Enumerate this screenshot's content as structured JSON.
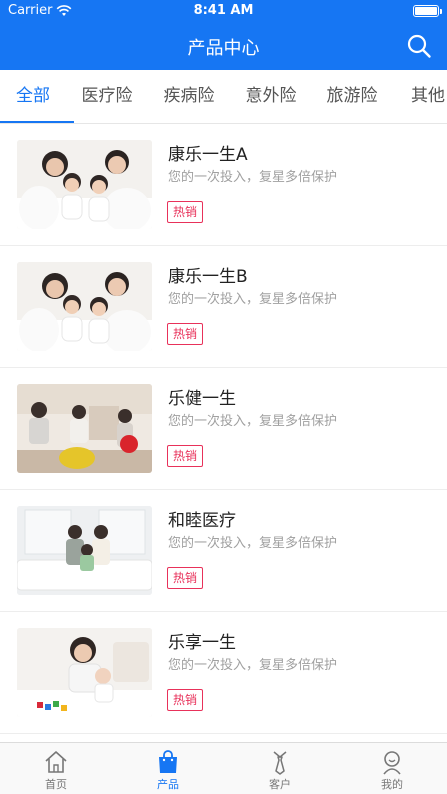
{
  "status_bar": {
    "carrier": "Carrier",
    "time": "8:41 AM"
  },
  "nav": {
    "title": "产品中心",
    "search_icon": "search-icon"
  },
  "tabs": [
    {
      "label": "全部",
      "active": true
    },
    {
      "label": "医疗险",
      "active": false
    },
    {
      "label": "疾病险",
      "active": false
    },
    {
      "label": "意外险",
      "active": false
    },
    {
      "label": "旅游险",
      "active": false
    },
    {
      "label": "其他",
      "active": false
    }
  ],
  "products": [
    {
      "name": "康乐一生A",
      "description": "您的一次投入，复星多倍保护",
      "badge": "热销",
      "image": "family-photo"
    },
    {
      "name": "康乐一生B",
      "description": "您的一次投入，复星多倍保护",
      "badge": "热销",
      "image": "family-photo"
    },
    {
      "name": "乐健一生",
      "description": "您的一次投入，复星多倍保护",
      "badge": "热销",
      "image": "family-living-room-photo"
    },
    {
      "name": "和睦医疗",
      "description": "您的一次投入，复星多倍保护",
      "badge": "热销",
      "image": "family-sofa-photo"
    },
    {
      "name": "乐享一生",
      "description": "您的一次投入，复星多倍保护",
      "badge": "热销",
      "image": "mother-baby-photo"
    }
  ],
  "tabbar": [
    {
      "label": "首页",
      "icon": "home-icon",
      "active": false
    },
    {
      "label": "产品",
      "icon": "shopping-bag-icon",
      "active": true
    },
    {
      "label": "客户",
      "icon": "customer-tie-icon",
      "active": false
    },
    {
      "label": "我的",
      "icon": "profile-icon",
      "active": false
    }
  ],
  "colors": {
    "primary": "#1676f3",
    "badge": "#e8315a"
  }
}
